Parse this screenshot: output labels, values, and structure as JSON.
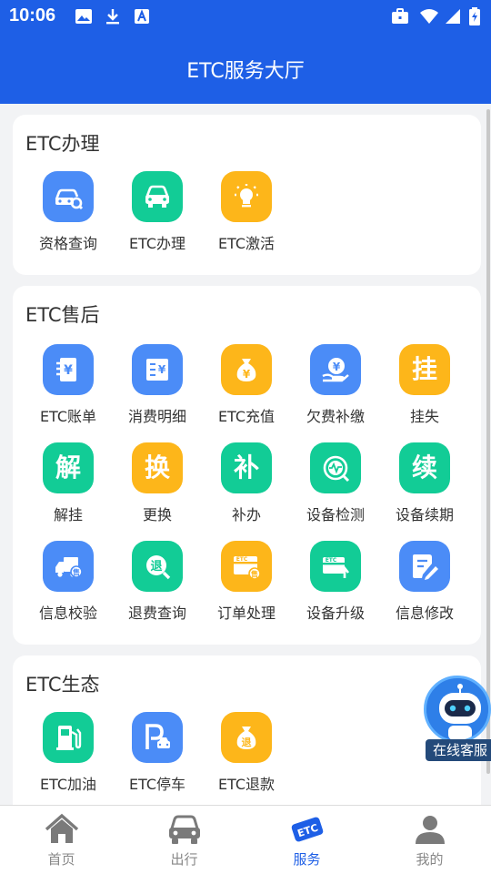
{
  "status_bar": {
    "time": "10:06"
  },
  "header": {
    "title": "ETC服务大厅"
  },
  "sections": [
    {
      "title": "ETC办理",
      "items": [
        {
          "label": "资格查询",
          "icon": "car-search-icon",
          "color": "#4b8cf7"
        },
        {
          "label": "ETC办理",
          "icon": "car-icon",
          "color": "#12cc96"
        },
        {
          "label": "ETC激活",
          "icon": "lightbulb-icon",
          "color": "#fdb61a"
        }
      ]
    },
    {
      "title": "ETC售后",
      "items": [
        {
          "label": "ETC账单",
          "icon": "bill-icon",
          "color": "#4b8cf7"
        },
        {
          "label": "消费明细",
          "icon": "invoice-icon",
          "color": "#4b8cf7"
        },
        {
          "label": "ETC充值",
          "icon": "money-bag-icon",
          "color": "#fdb61a"
        },
        {
          "label": "欠费补缴",
          "icon": "hand-coin-icon",
          "color": "#4b8cf7"
        },
        {
          "label": "挂失",
          "icon": "report-loss-icon",
          "glyph": "挂",
          "color": "#fdb61a"
        },
        {
          "label": "解挂",
          "icon": "unlock-loss-icon",
          "glyph": "解",
          "color": "#12cc96"
        },
        {
          "label": "更换",
          "icon": "replace-icon",
          "glyph": "换",
          "color": "#fdb61a"
        },
        {
          "label": "补办",
          "icon": "reissue-icon",
          "glyph": "补",
          "color": "#12cc96"
        },
        {
          "label": "设备检测",
          "icon": "device-check-icon",
          "color": "#12cc96"
        },
        {
          "label": "设备续期",
          "icon": "renew-icon",
          "glyph": "续",
          "color": "#12cc96"
        },
        {
          "label": "信息校验",
          "icon": "truck-verify-icon",
          "color": "#4b8cf7"
        },
        {
          "label": "退费查询",
          "icon": "refund-search-icon",
          "glyph": "退",
          "color": "#12cc96"
        },
        {
          "label": "订单处理",
          "icon": "etc-card-icon",
          "color": "#fdb61a"
        },
        {
          "label": "设备升级",
          "icon": "etc-upgrade-icon",
          "color": "#12cc96"
        },
        {
          "label": "信息修改",
          "icon": "edit-document-icon",
          "color": "#4b8cf7"
        }
      ]
    },
    {
      "title": "ETC生态",
      "items": [
        {
          "label": "ETC加油",
          "icon": "gas-pump-icon",
          "color": "#12cc96"
        },
        {
          "label": "ETC停车",
          "icon": "parking-icon",
          "color": "#4b8cf7"
        },
        {
          "label": "ETC退款",
          "icon": "refund-bag-icon",
          "glyph": "退",
          "color": "#fdb61a"
        }
      ]
    }
  ],
  "etc_card_text": "ETC",
  "float_service": {
    "label": "在线客服",
    "icon": "robot-icon"
  },
  "bottom_nav": [
    {
      "label": "首页",
      "icon": "home-icon"
    },
    {
      "label": "出行",
      "icon": "car-front-icon"
    },
    {
      "label": "服务",
      "icon": "etc-tag-icon",
      "active": true
    },
    {
      "label": "我的",
      "icon": "person-icon"
    }
  ],
  "colors": {
    "primary": "#1e5fe6",
    "blue": "#4b8cf7",
    "green": "#12cc96",
    "yellow": "#fdb61a"
  }
}
